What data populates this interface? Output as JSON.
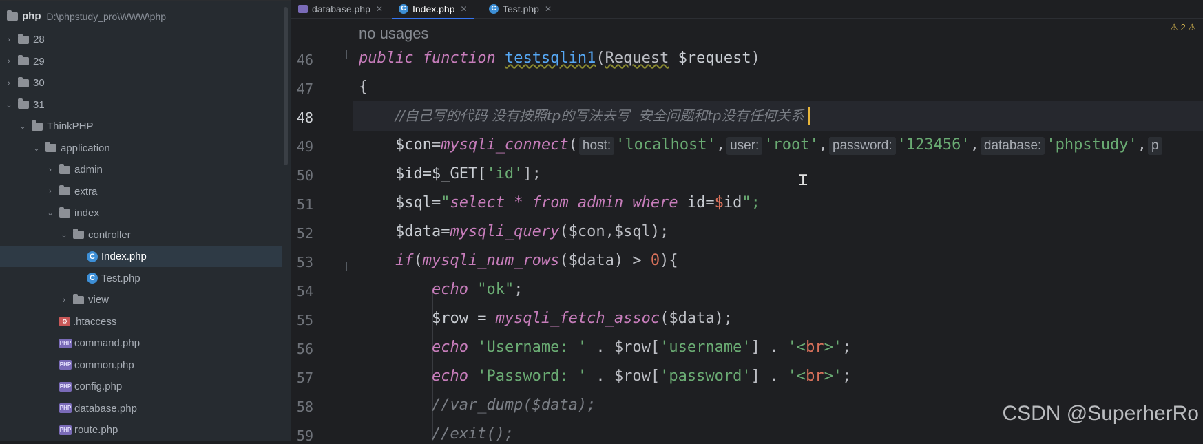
{
  "sidebar": {
    "root": {
      "name": "php",
      "path": "D:\\phpstudy_pro\\WWW\\php"
    },
    "items": [
      {
        "label": "28",
        "type": "folder",
        "depth": 0,
        "expanded": false
      },
      {
        "label": "29",
        "type": "folder",
        "depth": 0,
        "expanded": false
      },
      {
        "label": "30",
        "type": "folder",
        "depth": 0,
        "expanded": false
      },
      {
        "label": "31",
        "type": "folder",
        "depth": 0,
        "expanded": true
      },
      {
        "label": "ThinkPHP",
        "type": "folder",
        "depth": 1,
        "expanded": true
      },
      {
        "label": "application",
        "type": "folder",
        "depth": 2,
        "expanded": true
      },
      {
        "label": "admin",
        "type": "folder",
        "depth": 3,
        "expanded": false
      },
      {
        "label": "extra",
        "type": "folder",
        "depth": 3,
        "expanded": false
      },
      {
        "label": "index",
        "type": "folder",
        "depth": 3,
        "expanded": true
      },
      {
        "label": "controller",
        "type": "folder",
        "depth": 4,
        "expanded": true
      },
      {
        "label": "Index.php",
        "type": "class",
        "depth": 5,
        "selected": true
      },
      {
        "label": "Test.php",
        "type": "class",
        "depth": 5
      },
      {
        "label": "view",
        "type": "folder",
        "depth": 4,
        "expanded": false
      },
      {
        "label": ".htaccess",
        "type": "htaccess",
        "depth": 3
      },
      {
        "label": "command.php",
        "type": "php",
        "depth": 3
      },
      {
        "label": "common.php",
        "type": "php",
        "depth": 3
      },
      {
        "label": "config.php",
        "type": "php",
        "depth": 3
      },
      {
        "label": "database.php",
        "type": "php",
        "depth": 3
      },
      {
        "label": "route.php",
        "type": "php",
        "depth": 3
      }
    ]
  },
  "tabs": [
    {
      "label": "database.php",
      "icon": "php-file-icon"
    },
    {
      "label": "Index.php",
      "icon": "class-icon",
      "active": true
    },
    {
      "label": "Test.php",
      "icon": "class-icon"
    }
  ],
  "editor": {
    "usage_hint": "no usages",
    "warnings": "⚠ 2 ⚠",
    "line_numbers": [
      "46",
      "47",
      "48",
      "49",
      "50",
      "51",
      "52",
      "53",
      "54",
      "55",
      "56",
      "57",
      "58",
      "59"
    ],
    "current_line": "48",
    "param_hints": {
      "host": "host:",
      "user": "user:",
      "password": "password:",
      "database": "database:",
      "port": "p"
    },
    "tokens": {
      "public": "public",
      "function": "function",
      "fname": "testsqlin1",
      "lp": "(",
      "req_cls": "Request",
      "req_var": " $request",
      "rp": ")",
      "brace_open": "{",
      "comment48": "//自己写的代码 没有按照tp的写法去写  安全问题和tp没有任何关系 ",
      "con_var": "$con",
      "eq": "=",
      "connect": "mysqli_connect",
      "paren": "(",
      "s_localhost": "'localhost'",
      "s_root": "'root'",
      "s_pass": "'123456'",
      "s_db": "'phpstudy'",
      "comma": ",",
      "id_assign": "$id=$_GET[",
      "s_id": "'id'",
      "close_br": "];",
      "sql_var": "$sql=",
      "q1": "\"",
      "select": "select",
      "star": " * ",
      "from": "from",
      "admin": " admin ",
      "where": "where",
      "id_eq": " id=",
      "dollar": "$",
      "idname": "id",
      "q2": "\";",
      "data_var": "$data=",
      "query": "mysqli_query",
      "query_args": "($con,$sql);",
      "if": "if",
      "num_rows": "mysqli_num_rows",
      "nr_args": "($data) > ",
      "zero": "0",
      "nr_end": "){",
      "echo": "echo",
      "s_ok": "\"ok\"",
      "semi": ";",
      "row_assign": "$row = ",
      "fetch": "mysqli_fetch_assoc",
      "fetch_args": "($data);",
      "s_user_lbl": "'Username: '",
      "concat_row": " . $row[",
      "s_username": "'username'",
      "concat_end": "] . ",
      "s_br_open": "'<",
      "br": "br",
      "s_br_close": ">'",
      "s_pass_lbl": "'Password: '",
      "s_password": "'password'",
      "comment58": "//var_dump($data);",
      "comment59": "//exit();"
    }
  },
  "watermark": "CSDN @SuperherRo"
}
